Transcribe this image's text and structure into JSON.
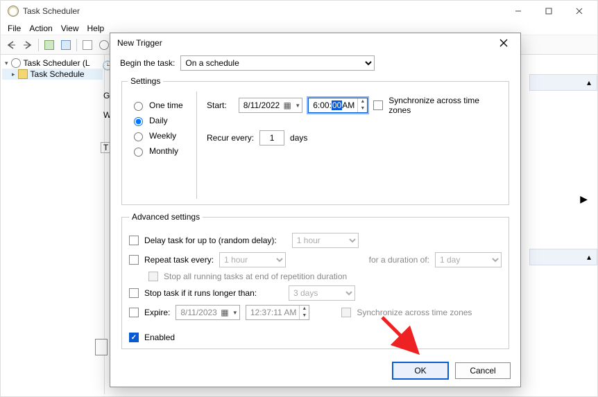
{
  "app": {
    "title": "Task Scheduler",
    "menus": [
      "File",
      "Action",
      "View",
      "Help"
    ]
  },
  "tree": {
    "root": "Task Scheduler (L",
    "child": "Task Schedule"
  },
  "stub": {
    "gen": "Gen",
    "w": "W",
    "t": "T"
  },
  "dialog": {
    "title": "New Trigger",
    "begin_label": "Begin the task:",
    "begin_value": "On a schedule",
    "settings_legend": "Settings",
    "freq": {
      "one_time": "One time",
      "daily": "Daily",
      "weekly": "Weekly",
      "monthly": "Monthly"
    },
    "start_label": "Start:",
    "start_date": "8/11/2022",
    "start_time_pre": "6:00:",
    "start_time_hi": "00",
    "start_time_post": " AM",
    "sync_tz": "Synchronize across time zones",
    "recur_label": "Recur every:",
    "recur_value": "1",
    "recur_unit": "days",
    "adv_legend": "Advanced settings",
    "delay_label": "Delay task for up to (random delay):",
    "delay_value": "1 hour",
    "repeat_label": "Repeat task every:",
    "repeat_value": "1 hour",
    "duration_label": "for a duration of:",
    "duration_value": "1 day",
    "stop_all_label": "Stop all running tasks at end of repetition duration",
    "stop_if_label": "Stop task if it runs longer than:",
    "stop_if_value": "3 days",
    "expire_label": "Expire:",
    "expire_date": "8/11/2023",
    "expire_time": "12:37:11 AM",
    "sync_tz2": "Synchronize across time zones",
    "enabled_label": "Enabled",
    "ok": "OK",
    "cancel": "Cancel"
  }
}
